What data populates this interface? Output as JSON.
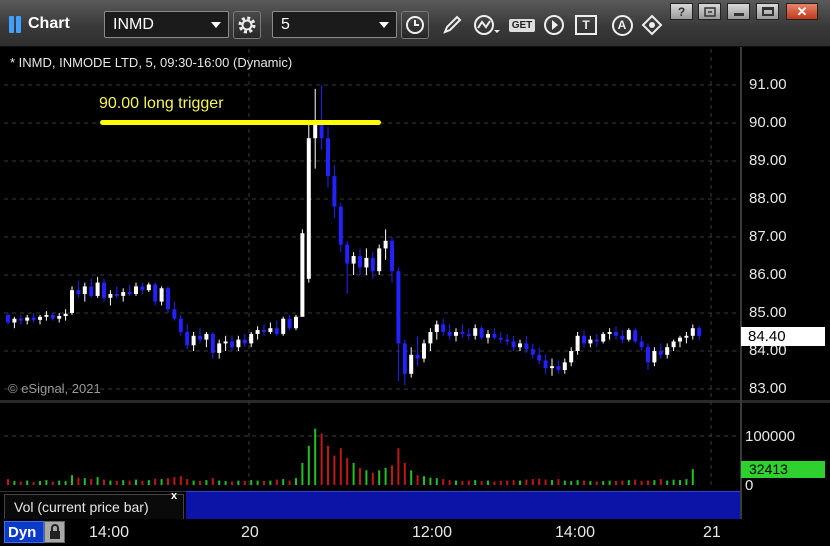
{
  "app": {
    "title": "Chart"
  },
  "toolbar": {
    "symbol_value": "INMD",
    "interval_value": "5",
    "icons": [
      "settings-gear-icon",
      "clock-icon",
      "pencil-icon",
      "study-icon",
      "get-icon",
      "play-icon",
      "text-tool-icon",
      "alert-icon",
      "link-icon"
    ],
    "get_label": "GET",
    "text_tool_label": "T",
    "alert_label": "A"
  },
  "window_controls": [
    "help-button",
    "restore-button",
    "maximize-button",
    "close-button"
  ],
  "chart": {
    "header": "* INMD, INMODE LTD, 5, 09:30-16:00 (Dynamic)",
    "copyright": "© eSignal, 2021",
    "annotation": {
      "text": "90.00 long trigger",
      "level": 90.0,
      "color": "#ffff00"
    },
    "price_ticks": [
      "91.00",
      "90.00",
      "89.00",
      "88.00",
      "87.00",
      "86.00",
      "85.00",
      "84.00",
      "83.00"
    ],
    "last_price": "84.40",
    "volume_ticks": [
      "100000",
      "0"
    ],
    "last_volume": "32413",
    "volume_tab": "Vol (current price bar)",
    "volume_tab_close": "x",
    "dyn_label": "Dyn",
    "time_ticks": [
      "14:00",
      "20",
      "12:00",
      "14:00",
      "21"
    ]
  },
  "colors": {
    "up_candle": "#ffffff",
    "down_candle": "#2222ff",
    "vol_up": "#22c022",
    "vol_down": "#c01818",
    "grid": "#3a3a3a",
    "last_volume_bg": "#2ed12e"
  },
  "chart_data": {
    "type": "candlestick",
    "y_range": [
      82.8,
      91.5
    ],
    "volume_range": [
      0,
      130000
    ],
    "candles": [
      {
        "o": 84.95,
        "h": 85.0,
        "l": 84.7,
        "c": 84.75
      },
      {
        "o": 84.75,
        "h": 84.9,
        "l": 84.6,
        "c": 84.85
      },
      {
        "o": 84.85,
        "h": 84.95,
        "l": 84.7,
        "c": 84.8
      },
      {
        "o": 84.8,
        "h": 84.95,
        "l": 84.7,
        "c": 84.88
      },
      {
        "o": 84.88,
        "h": 85.0,
        "l": 84.75,
        "c": 84.82
      },
      {
        "o": 84.82,
        "h": 84.95,
        "l": 84.7,
        "c": 84.9
      },
      {
        "o": 84.9,
        "h": 85.05,
        "l": 84.8,
        "c": 84.95
      },
      {
        "o": 84.95,
        "h": 85.0,
        "l": 84.8,
        "c": 84.85
      },
      {
        "o": 84.85,
        "h": 85.0,
        "l": 84.75,
        "c": 84.92
      },
      {
        "o": 84.92,
        "h": 85.1,
        "l": 84.8,
        "c": 84.98
      },
      {
        "o": 85.0,
        "h": 85.7,
        "l": 84.95,
        "c": 85.6
      },
      {
        "o": 85.6,
        "h": 85.85,
        "l": 85.4,
        "c": 85.5
      },
      {
        "o": 85.5,
        "h": 85.8,
        "l": 85.3,
        "c": 85.7
      },
      {
        "o": 85.7,
        "h": 85.9,
        "l": 85.4,
        "c": 85.45
      },
      {
        "o": 85.45,
        "h": 85.95,
        "l": 85.4,
        "c": 85.8
      },
      {
        "o": 85.8,
        "h": 85.9,
        "l": 85.3,
        "c": 85.4
      },
      {
        "o": 85.4,
        "h": 85.6,
        "l": 85.2,
        "c": 85.5
      },
      {
        "o": 85.5,
        "h": 85.7,
        "l": 85.4,
        "c": 85.45
      },
      {
        "o": 85.45,
        "h": 85.65,
        "l": 85.3,
        "c": 85.55
      },
      {
        "o": 85.55,
        "h": 85.75,
        "l": 85.45,
        "c": 85.5
      },
      {
        "o": 85.5,
        "h": 85.8,
        "l": 85.45,
        "c": 85.7
      },
      {
        "o": 85.7,
        "h": 85.8,
        "l": 85.5,
        "c": 85.6
      },
      {
        "o": 85.6,
        "h": 85.8,
        "l": 85.55,
        "c": 85.75
      },
      {
        "o": 85.75,
        "h": 85.8,
        "l": 85.2,
        "c": 85.3
      },
      {
        "o": 85.3,
        "h": 85.7,
        "l": 85.2,
        "c": 85.65
      },
      {
        "o": 85.65,
        "h": 85.7,
        "l": 85.0,
        "c": 85.1
      },
      {
        "o": 85.1,
        "h": 85.3,
        "l": 84.8,
        "c": 84.85
      },
      {
        "o": 84.85,
        "h": 84.95,
        "l": 84.4,
        "c": 84.5
      },
      {
        "o": 84.5,
        "h": 84.7,
        "l": 84.05,
        "c": 84.15
      },
      {
        "o": 84.15,
        "h": 84.5,
        "l": 84.0,
        "c": 84.4
      },
      {
        "o": 84.4,
        "h": 84.6,
        "l": 84.2,
        "c": 84.3
      },
      {
        "o": 84.3,
        "h": 84.5,
        "l": 84.1,
        "c": 84.45
      },
      {
        "o": 84.45,
        "h": 84.5,
        "l": 83.8,
        "c": 83.95
      },
      {
        "o": 83.95,
        "h": 84.3,
        "l": 83.8,
        "c": 84.2
      },
      {
        "o": 84.2,
        "h": 84.4,
        "l": 84.0,
        "c": 84.25
      },
      {
        "o": 84.25,
        "h": 84.4,
        "l": 84.0,
        "c": 84.1
      },
      {
        "o": 84.1,
        "h": 84.4,
        "l": 84.0,
        "c": 84.3
      },
      {
        "o": 84.3,
        "h": 84.45,
        "l": 84.1,
        "c": 84.2
      },
      {
        "o": 84.2,
        "h": 84.5,
        "l": 84.1,
        "c": 84.45
      },
      {
        "o": 84.45,
        "h": 84.65,
        "l": 84.3,
        "c": 84.55
      },
      {
        "o": 84.55,
        "h": 84.7,
        "l": 84.4,
        "c": 84.5
      },
      {
        "o": 84.5,
        "h": 84.75,
        "l": 84.45,
        "c": 84.6
      },
      {
        "o": 84.6,
        "h": 84.8,
        "l": 84.4,
        "c": 84.45
      },
      {
        "o": 84.45,
        "h": 84.9,
        "l": 84.4,
        "c": 84.85
      },
      {
        "o": 84.85,
        "h": 84.95,
        "l": 84.55,
        "c": 84.6
      },
      {
        "o": 84.6,
        "h": 84.95,
        "l": 84.55,
        "c": 84.9
      },
      {
        "o": 84.9,
        "h": 87.2,
        "l": 85.2,
        "c": 87.1
      },
      {
        "o": 85.9,
        "h": 90.0,
        "l": 85.8,
        "c": 89.6
      },
      {
        "o": 89.6,
        "h": 90.9,
        "l": 88.8,
        "c": 90.0
      },
      {
        "o": 90.0,
        "h": 91.0,
        "l": 89.3,
        "c": 89.6
      },
      {
        "o": 89.6,
        "h": 89.9,
        "l": 88.3,
        "c": 88.6
      },
      {
        "o": 88.6,
        "h": 88.9,
        "l": 87.5,
        "c": 87.8
      },
      {
        "o": 87.8,
        "h": 87.9,
        "l": 86.6,
        "c": 86.8
      },
      {
        "o": 86.8,
        "h": 86.9,
        "l": 85.5,
        "c": 86.3
      },
      {
        "o": 86.3,
        "h": 86.6,
        "l": 86.0,
        "c": 86.5
      },
      {
        "o": 86.5,
        "h": 86.7,
        "l": 86.0,
        "c": 86.2
      },
      {
        "o": 86.2,
        "h": 86.7,
        "l": 86.0,
        "c": 86.45
      },
      {
        "o": 86.45,
        "h": 86.6,
        "l": 85.9,
        "c": 86.1
      },
      {
        "o": 86.1,
        "h": 86.8,
        "l": 86.0,
        "c": 86.7
      },
      {
        "o": 86.7,
        "h": 87.2,
        "l": 86.4,
        "c": 86.9
      },
      {
        "o": 86.9,
        "h": 87.0,
        "l": 85.8,
        "c": 86.1
      },
      {
        "o": 86.1,
        "h": 86.2,
        "l": 83.2,
        "c": 84.2
      },
      {
        "o": 84.2,
        "h": 84.3,
        "l": 83.1,
        "c": 83.4
      },
      {
        "o": 83.4,
        "h": 84.1,
        "l": 83.3,
        "c": 83.9
      },
      {
        "o": 83.9,
        "h": 84.4,
        "l": 83.6,
        "c": 83.8
      },
      {
        "o": 83.8,
        "h": 84.3,
        "l": 83.7,
        "c": 84.2
      },
      {
        "o": 84.2,
        "h": 84.6,
        "l": 84.0,
        "c": 84.5
      },
      {
        "o": 84.5,
        "h": 84.8,
        "l": 84.3,
        "c": 84.7
      },
      {
        "o": 84.7,
        "h": 84.85,
        "l": 84.4,
        "c": 84.5
      },
      {
        "o": 84.5,
        "h": 84.7,
        "l": 84.3,
        "c": 84.4
      },
      {
        "o": 84.4,
        "h": 84.6,
        "l": 84.25,
        "c": 84.5
      },
      {
        "o": 84.5,
        "h": 84.7,
        "l": 84.35,
        "c": 84.45
      },
      {
        "o": 84.45,
        "h": 84.6,
        "l": 84.3,
        "c": 84.4
      },
      {
        "o": 84.4,
        "h": 84.7,
        "l": 84.3,
        "c": 84.6
      },
      {
        "o": 84.6,
        "h": 84.65,
        "l": 84.3,
        "c": 84.35
      },
      {
        "o": 84.35,
        "h": 84.55,
        "l": 84.2,
        "c": 84.45
      },
      {
        "o": 84.45,
        "h": 84.6,
        "l": 84.3,
        "c": 84.35
      },
      {
        "o": 84.35,
        "h": 84.5,
        "l": 84.2,
        "c": 84.3
      },
      {
        "o": 84.3,
        "h": 84.45,
        "l": 84.15,
        "c": 84.25
      },
      {
        "o": 84.25,
        "h": 84.4,
        "l": 84.0,
        "c": 84.1
      },
      {
        "o": 84.1,
        "h": 84.3,
        "l": 84.0,
        "c": 84.2
      },
      {
        "o": 84.2,
        "h": 84.4,
        "l": 83.95,
        "c": 84.05
      },
      {
        "o": 84.05,
        "h": 84.2,
        "l": 83.8,
        "c": 83.9
      },
      {
        "o": 83.9,
        "h": 84.1,
        "l": 83.65,
        "c": 83.75
      },
      {
        "o": 83.75,
        "h": 83.9,
        "l": 83.4,
        "c": 83.55
      },
      {
        "o": 83.55,
        "h": 83.8,
        "l": 83.35,
        "c": 83.6
      },
      {
        "o": 83.6,
        "h": 83.75,
        "l": 83.4,
        "c": 83.5
      },
      {
        "o": 83.5,
        "h": 83.8,
        "l": 83.4,
        "c": 83.7
      },
      {
        "o": 83.7,
        "h": 84.1,
        "l": 83.6,
        "c": 84.0
      },
      {
        "o": 84.0,
        "h": 84.5,
        "l": 83.9,
        "c": 84.4
      },
      {
        "o": 84.4,
        "h": 84.55,
        "l": 84.1,
        "c": 84.2
      },
      {
        "o": 84.2,
        "h": 84.4,
        "l": 84.1,
        "c": 84.3
      },
      {
        "o": 84.3,
        "h": 84.45,
        "l": 84.1,
        "c": 84.25
      },
      {
        "o": 84.25,
        "h": 84.5,
        "l": 84.2,
        "c": 84.45
      },
      {
        "o": 84.45,
        "h": 84.6,
        "l": 84.3,
        "c": 84.5
      },
      {
        "o": 84.5,
        "h": 84.65,
        "l": 84.3,
        "c": 84.4
      },
      {
        "o": 84.4,
        "h": 84.55,
        "l": 84.2,
        "c": 84.3
      },
      {
        "o": 84.3,
        "h": 84.6,
        "l": 84.25,
        "c": 84.55
      },
      {
        "o": 84.55,
        "h": 84.6,
        "l": 84.2,
        "c": 84.25
      },
      {
        "o": 84.25,
        "h": 84.4,
        "l": 84.0,
        "c": 84.1
      },
      {
        "o": 84.1,
        "h": 84.2,
        "l": 83.5,
        "c": 83.7
      },
      {
        "o": 83.7,
        "h": 84.1,
        "l": 83.6,
        "c": 84.0
      },
      {
        "o": 84.0,
        "h": 84.2,
        "l": 83.8,
        "c": 83.9
      },
      {
        "o": 83.9,
        "h": 84.2,
        "l": 83.8,
        "c": 84.1
      },
      {
        "o": 84.1,
        "h": 84.3,
        "l": 84.0,
        "c": 84.25
      },
      {
        "o": 84.25,
        "h": 84.4,
        "l": 84.1,
        "c": 84.35
      },
      {
        "o": 84.35,
        "h": 84.5,
        "l": 84.2,
        "c": 84.4
      },
      {
        "o": 84.4,
        "h": 84.7,
        "l": 84.3,
        "c": 84.6
      },
      {
        "o": 84.6,
        "h": 84.65,
        "l": 84.3,
        "c": 84.4
      }
    ],
    "volumes": [
      12000,
      8000,
      7000,
      9000,
      6000,
      8000,
      10000,
      7000,
      9000,
      8000,
      20000,
      15000,
      14000,
      12000,
      16000,
      11000,
      9000,
      8000,
      10000,
      9000,
      11000,
      8000,
      10000,
      13000,
      12000,
      14000,
      16000,
      18000,
      12000,
      9000,
      8000,
      10000,
      14000,
      9000,
      8000,
      7000,
      9000,
      8000,
      10000,
      9000,
      8000,
      9000,
      11000,
      12000,
      9000,
      14000,
      45000,
      80000,
      115000,
      105000,
      80000,
      60000,
      75000,
      55000,
      45000,
      35000,
      30000,
      25000,
      30000,
      35000,
      40000,
      75000,
      45000,
      30000,
      20000,
      18000,
      15000,
      14000,
      12000,
      10000,
      9000,
      8000,
      9000,
      10000,
      8000,
      9000,
      7000,
      8000,
      9000,
      10000,
      9000,
      11000,
      12000,
      13000,
      11000,
      10000,
      12000,
      9000,
      8000,
      10000,
      9000,
      8000,
      7000,
      8000,
      9000,
      8000,
      9000,
      10000,
      11000,
      8000,
      9000,
      10000,
      12000,
      9000,
      11000,
      10000,
      12000,
      32413
    ]
  }
}
